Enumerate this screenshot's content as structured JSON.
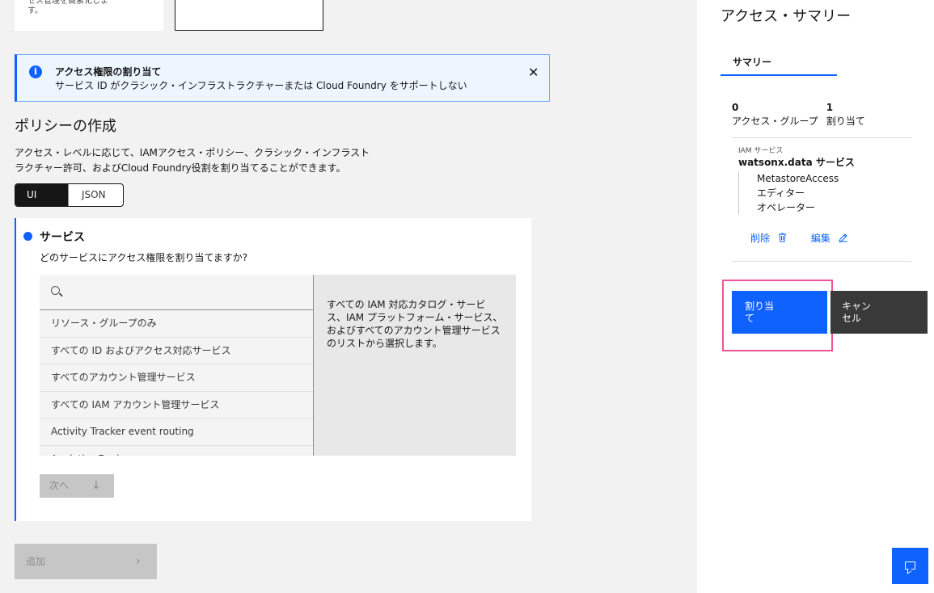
{
  "top": {
    "tile_text": "セス管理を簡素化しま す。"
  },
  "notification": {
    "title": "アクセス権限の割り当て",
    "subtitle": "サービス ID がクラシック・インフラストラクチャーまたは Cloud Foundry をサポートしない",
    "close": "✕"
  },
  "policy": {
    "heading": "ポリシーの作成",
    "desc_line1": "アクセス・レベルに応じて、IAMアクセス・ポリシー、クラシック・インフラスト",
    "desc_line2": "ラクチャー許可、およびCloud Foundry役割を割り当てることができます。",
    "switch_ui": "UI",
    "switch_json": "JSON"
  },
  "step": {
    "title": "サービス",
    "question": "どのサービスにアクセス権限を割り当てますか?",
    "search_placeholder": "",
    "options": [
      "リソース・グループのみ",
      "すべての ID およびアクセス対応サービス",
      "すべてのアカウント管理サービス",
      "すべての IAM アカウント管理サービス",
      "Activity Tracker event routing",
      "Analytics Engine"
    ],
    "info": "すべての IAM 対応カタログ・サービス、IAM プラットフォーム・サービス、およびすべてのアカウント管理サービスのリストから選択します。",
    "next": "次へ",
    "next_arrow": "↓"
  },
  "add": {
    "label": "追加",
    "arrow": "›"
  },
  "summary": {
    "title": "アクセス・サマリー",
    "tab": "サマリー",
    "groups_count": "0",
    "groups_label": "アクセス・グループ",
    "assign_count": "1",
    "assign_label": "割り当て",
    "service_caption": "IAM サービス",
    "service_name": "watsonx.data サービス",
    "roles": [
      "MetastoreAccess",
      "エディター",
      "オペレーター"
    ],
    "delete": "削除",
    "edit": "編集",
    "assign_button": "割り当て",
    "cancel_button": "キャンセル"
  }
}
